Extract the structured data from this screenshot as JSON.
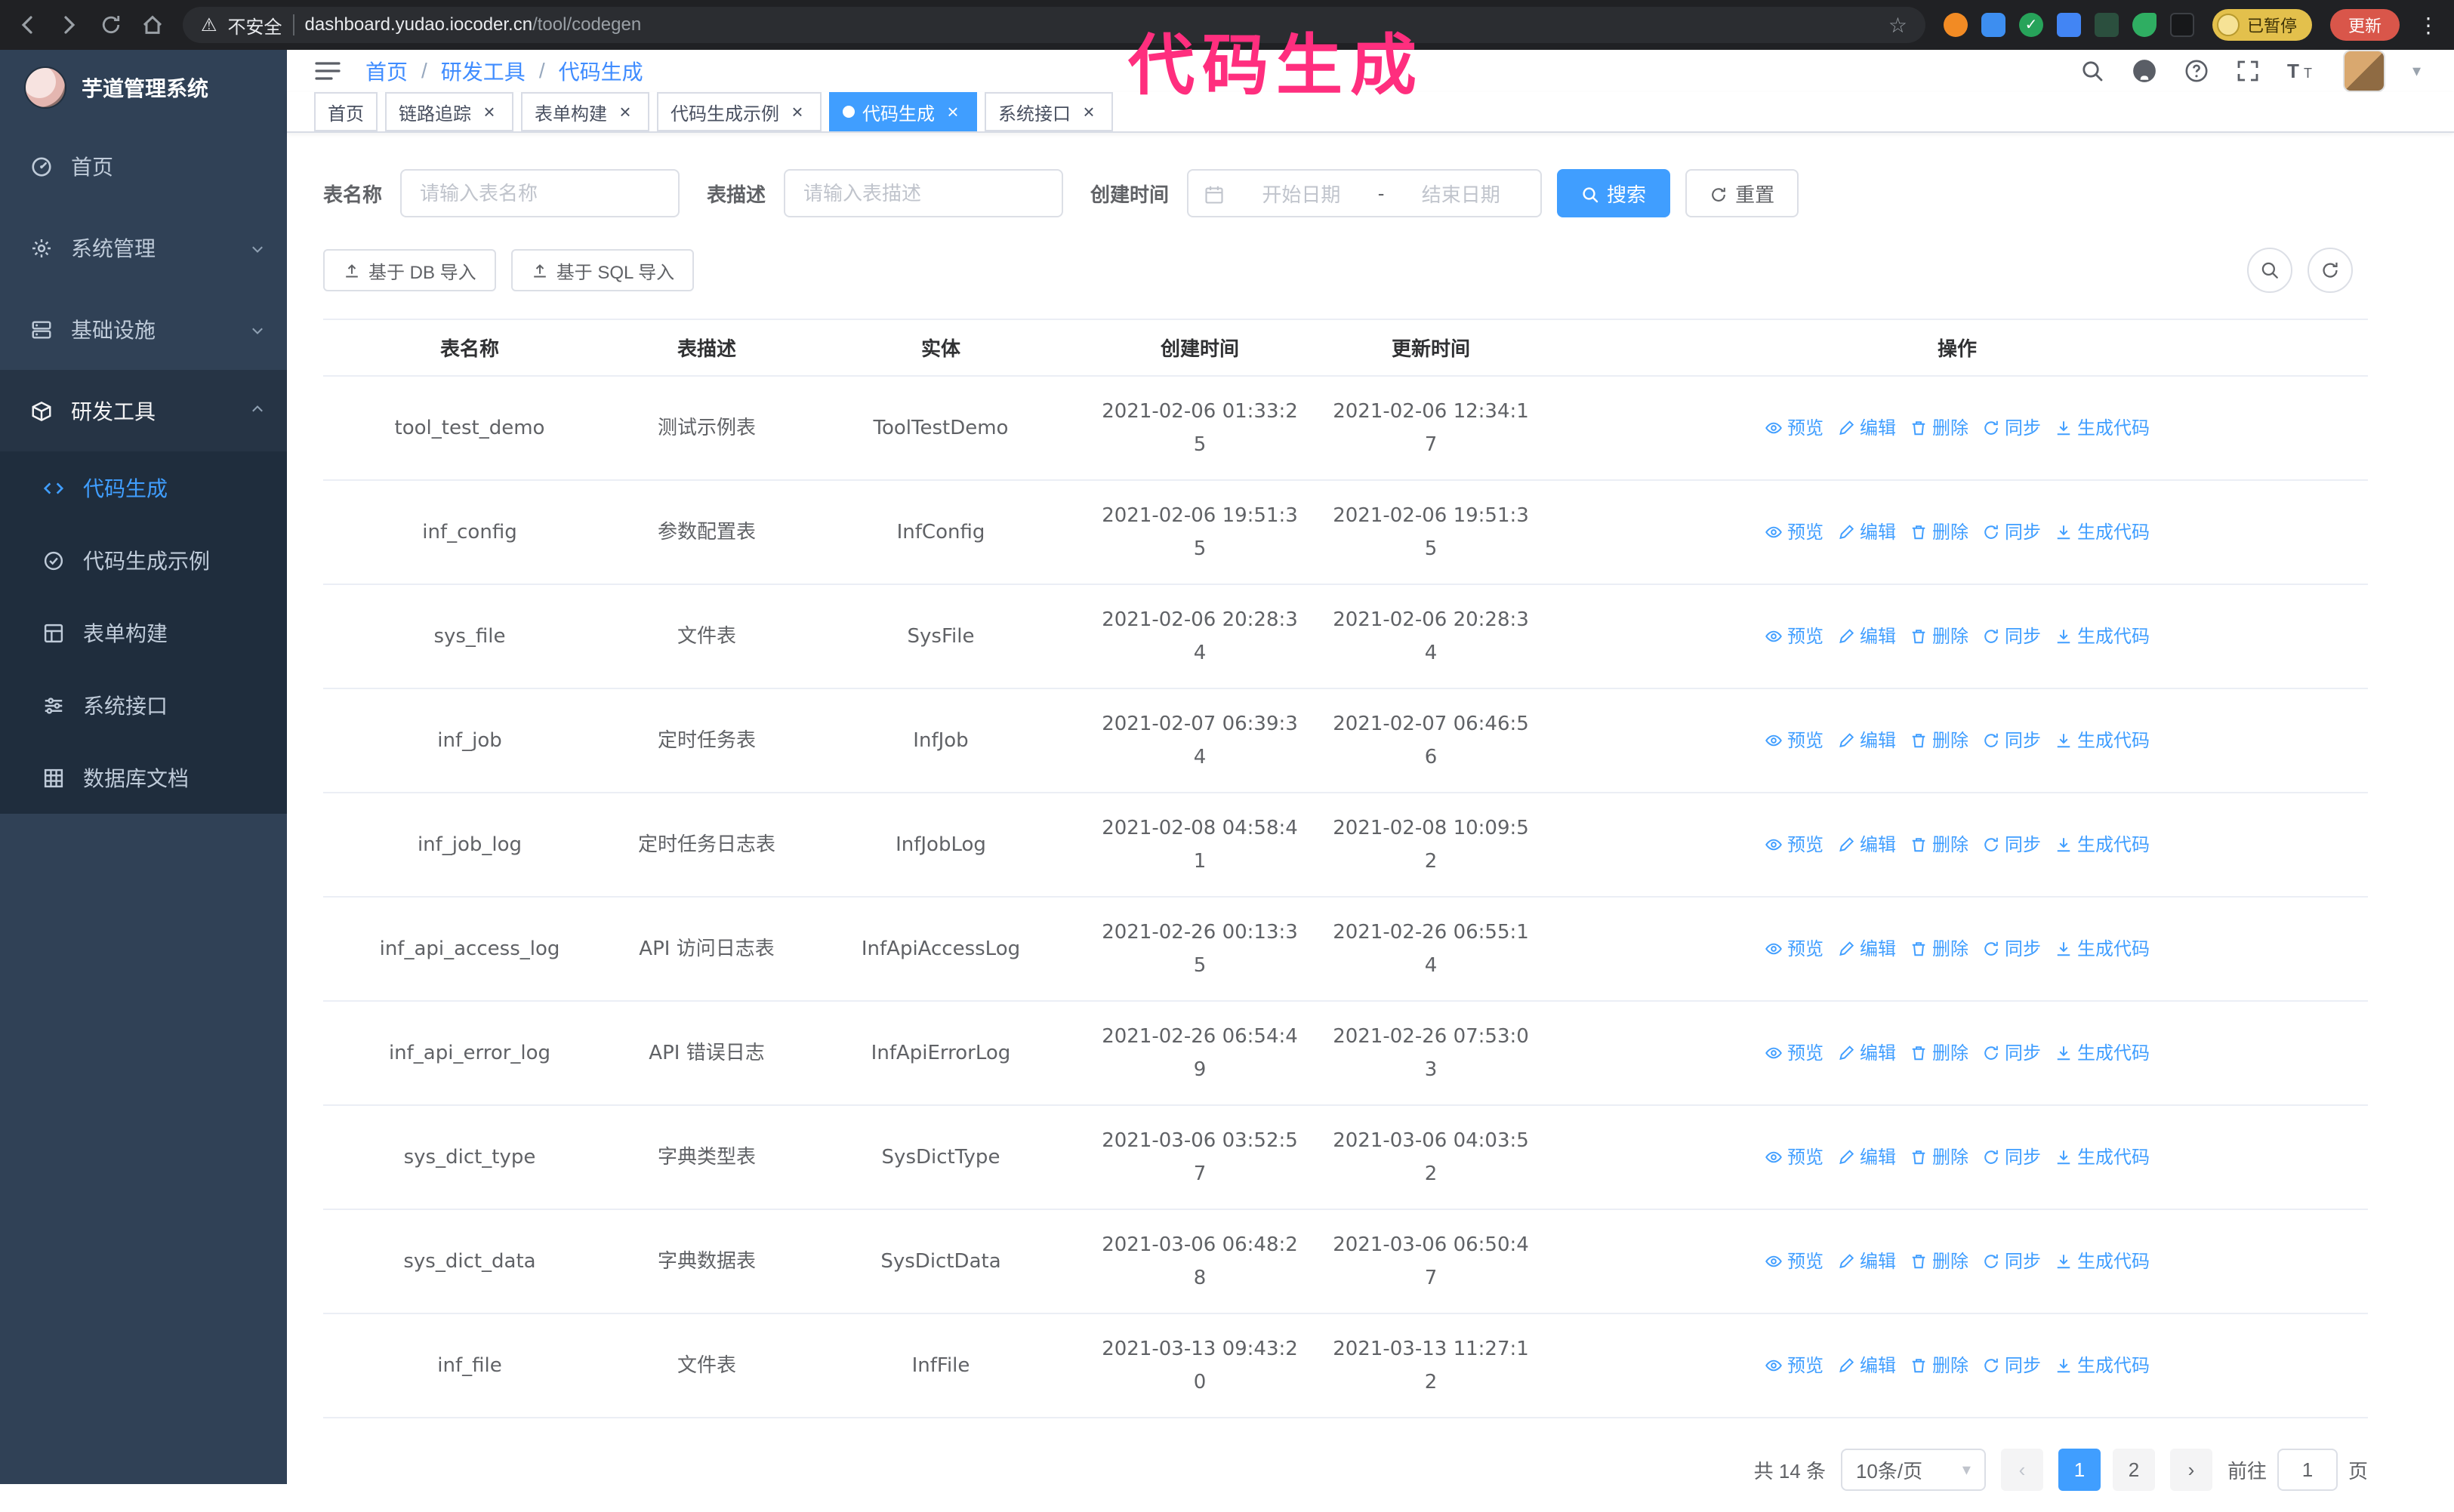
{
  "annotation": "代码生成",
  "icons": {
    "warning": "⚠",
    "star": "☆",
    "kebab": "⋮",
    "close": "×",
    "slash": "/",
    "prev": "‹",
    "next": "›",
    "caret_down": "▾",
    "check": "✓"
  },
  "browser": {
    "security_warning": "不安全",
    "url_host": "dashboard.yudao.iocoder.cn",
    "url_path": "/tool/codegen",
    "paused_badge": "已暂停",
    "update_button": "更新"
  },
  "sidebar": {
    "logo_title": "芋道管理系统",
    "items": [
      {
        "label": "首页"
      },
      {
        "label": "系统管理"
      },
      {
        "label": "基础设施"
      },
      {
        "label": "研发工具"
      }
    ],
    "sub_items": [
      {
        "label": "代码生成",
        "active": true
      },
      {
        "label": "代码生成示例",
        "active": false
      },
      {
        "label": "表单构建",
        "active": false
      },
      {
        "label": "系统接口",
        "active": false
      },
      {
        "label": "数据库文档",
        "active": false
      }
    ]
  },
  "header": {
    "breadcrumb": [
      "首页",
      "研发工具",
      "代码生成"
    ]
  },
  "tabs": [
    {
      "name": "home",
      "label": "首页",
      "closable": false,
      "active": false
    },
    {
      "name": "tracer",
      "label": "链路追踪",
      "closable": true,
      "active": false
    },
    {
      "name": "form-build",
      "label": "表单构建",
      "closable": true,
      "active": false
    },
    {
      "name": "codegen-example",
      "label": "代码生成示例",
      "closable": true,
      "active": false
    },
    {
      "name": "codegen",
      "label": "代码生成",
      "closable": true,
      "active": true
    },
    {
      "name": "api",
      "label": "系统接口",
      "closable": true,
      "active": false
    }
  ],
  "filters": {
    "table_name_label": "表名称",
    "table_name_placeholder": "请输入表名称",
    "table_desc_label": "表描述",
    "table_desc_placeholder": "请输入表描述",
    "create_time_label": "创建时间",
    "start_date_placeholder": "开始日期",
    "range_separator": "-",
    "end_date_placeholder": "结束日期",
    "search_button": "搜索",
    "reset_button": "重置"
  },
  "toolbar": {
    "import_db_button": "基于 DB 导入",
    "import_sql_button": "基于 SQL 导入"
  },
  "table": {
    "columns": [
      "表名称",
      "表描述",
      "实体",
      "创建时间",
      "更新时间",
      "操作"
    ],
    "actions": [
      "预览",
      "编辑",
      "删除",
      "同步",
      "生成代码"
    ],
    "rows": [
      {
        "name": "tool_test_demo",
        "desc": "测试示例表",
        "entity": "ToolTestDemo",
        "created": "2021-02-06 01:33:25",
        "updated": "2021-02-06 12:34:17"
      },
      {
        "name": "inf_config",
        "desc": "参数配置表",
        "entity": "InfConfig",
        "created": "2021-02-06 19:51:35",
        "updated": "2021-02-06 19:51:35"
      },
      {
        "name": "sys_file",
        "desc": "文件表",
        "entity": "SysFile",
        "created": "2021-02-06 20:28:34",
        "updated": "2021-02-06 20:28:34"
      },
      {
        "name": "inf_job",
        "desc": "定时任务表",
        "entity": "InfJob",
        "created": "2021-02-07 06:39:34",
        "updated": "2021-02-07 06:46:56"
      },
      {
        "name": "inf_job_log",
        "desc": "定时任务日志表",
        "entity": "InfJobLog",
        "created": "2021-02-08 04:58:41",
        "updated": "2021-02-08 10:09:52"
      },
      {
        "name": "inf_api_access_log",
        "desc": "API 访问日志表",
        "entity": "InfApiAccessLog",
        "created": "2021-02-26 00:13:35",
        "updated": "2021-02-26 06:55:14"
      },
      {
        "name": "inf_api_error_log",
        "desc": "API 错误日志",
        "entity": "InfApiErrorLog",
        "created": "2021-02-26 06:54:49",
        "updated": "2021-02-26 07:53:03"
      },
      {
        "name": "sys_dict_type",
        "desc": "字典类型表",
        "entity": "SysDictType",
        "created": "2021-03-06 03:52:57",
        "updated": "2021-03-06 04:03:52"
      },
      {
        "name": "sys_dict_data",
        "desc": "字典数据表",
        "entity": "SysDictData",
        "created": "2021-03-06 06:48:28",
        "updated": "2021-03-06 06:50:47"
      },
      {
        "name": "inf_file",
        "desc": "文件表",
        "entity": "InfFile",
        "created": "2021-03-13 09:43:20",
        "updated": "2021-03-13 11:27:12"
      }
    ]
  },
  "pagination": {
    "total_label": "共 14 条",
    "page_size_label": "10条/页",
    "pages": [
      "1",
      "2"
    ],
    "active_page": "1",
    "goto_label": "前往",
    "goto_value": "1",
    "page_unit": "页"
  }
}
